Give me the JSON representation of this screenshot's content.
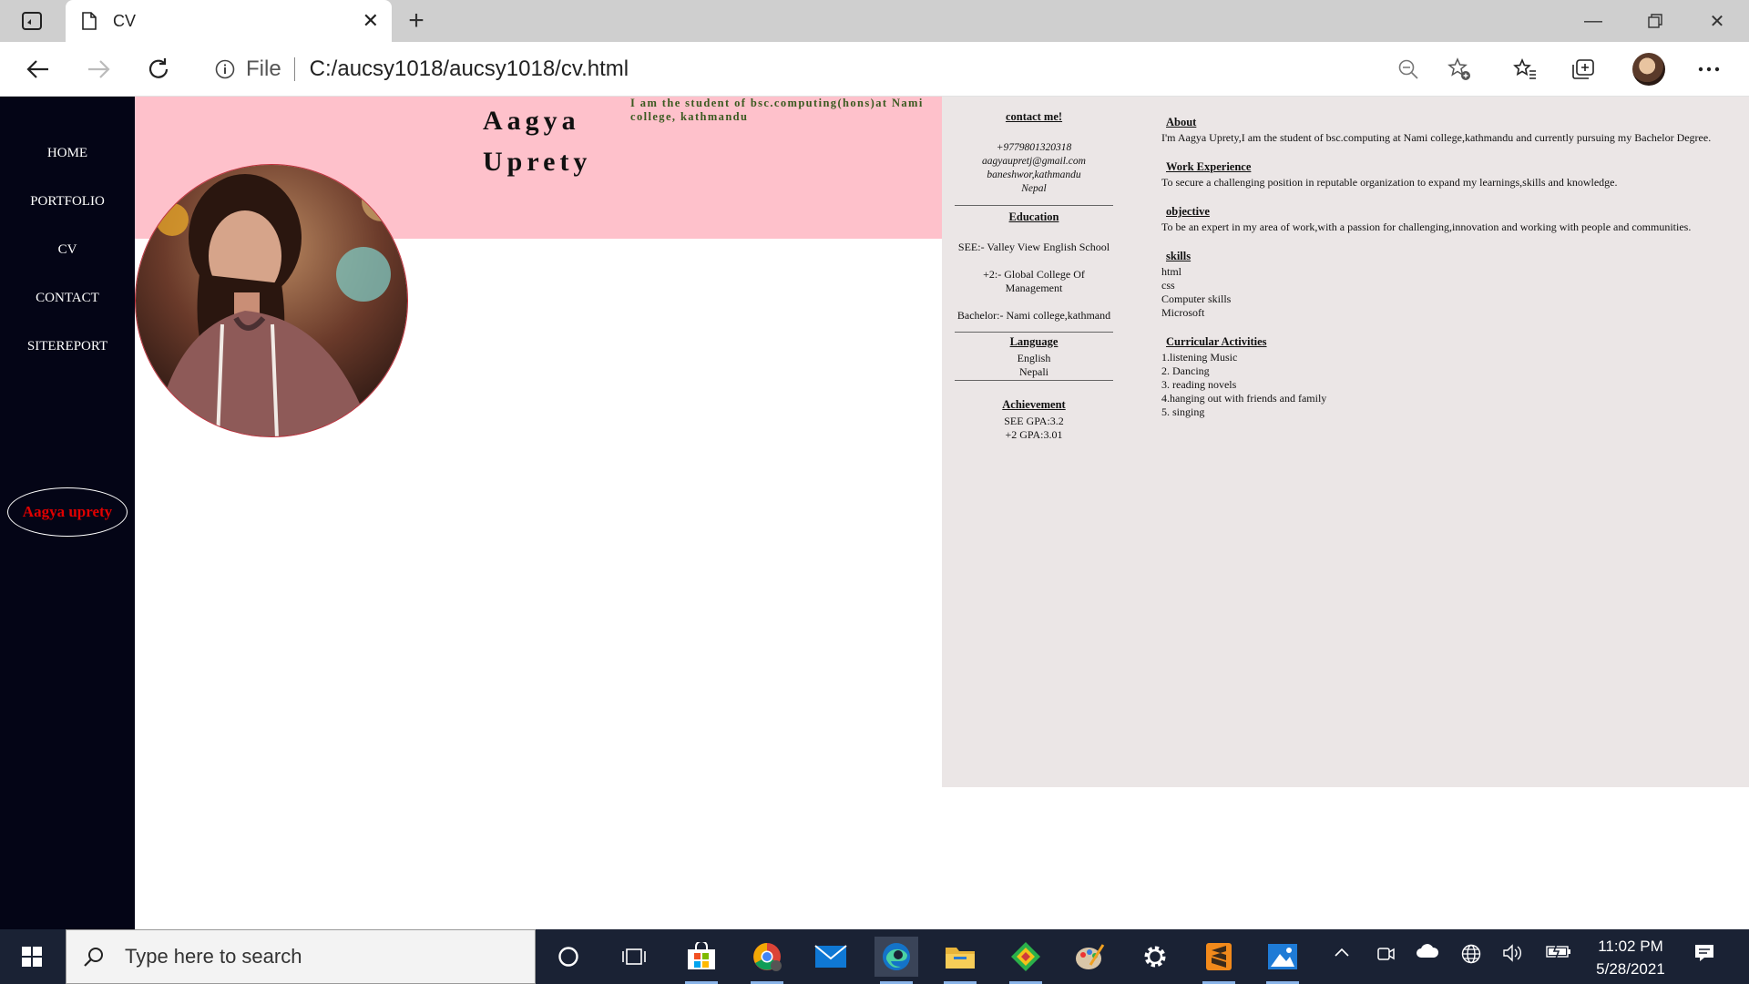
{
  "browser": {
    "tab_title": "CV",
    "address_scheme": "File",
    "address_url": "C:/aucsy1018/aucsy1018/cv.html"
  },
  "sidebar": {
    "nav": [
      "HOME",
      "PORTFOLIO",
      "CV",
      "CONTACT",
      "SITEREPORT"
    ],
    "owner_name": "Aagya uprety"
  },
  "header": {
    "name_first": "Aagya",
    "name_last": "Uprety",
    "tagline": "I am the student of bsc.computing(hons)at Nami college, kathmandu"
  },
  "contact": {
    "heading": "contact me!",
    "phone": "+9779801320318",
    "email": "aagyaupretj@gmail.com",
    "address": "baneshwor,kathmandu",
    "country": "Nepal"
  },
  "education": {
    "heading": "Education",
    "items": [
      "SEE:- Valley View English School",
      "+2:- Global College Of Management",
      "Bachelor:- Nami college,kathmand"
    ]
  },
  "language": {
    "heading": "Language",
    "items": [
      "English",
      "Nepali"
    ]
  },
  "achievement": {
    "heading": "Achievement",
    "items": [
      "SEE GPA:3.2",
      "+2 GPA:3.01"
    ]
  },
  "about": {
    "heading": "About",
    "text": "I'm Aagya Uprety,I am the student of bsc.computing at Nami college,kathmandu and currently pursuing my Bachelor Degree."
  },
  "work": {
    "heading": "Work Experience",
    "text": "To secure a challenging position in reputable organization to expand my learnings,skills and knowledge."
  },
  "objective": {
    "heading": "objective",
    "text": "To be an expert in my area of work,with a passion for challenging,innovation and working with people and communities."
  },
  "skills": {
    "heading": "skills",
    "items": [
      "html",
      "css",
      "Computer skills",
      "Microsoft"
    ]
  },
  "activities": {
    "heading": "Curricular Activities",
    "items": [
      "1.listening Music",
      "2. Dancing",
      "3. reading novels",
      "4.hanging out with friends and family",
      "5. singing"
    ]
  },
  "taskbar": {
    "search_placeholder": "Type here to search",
    "time": "11:02 PM",
    "date": "5/28/2021"
  },
  "colors": {
    "sidebar_bg": "#040516",
    "header_band": "#fec1cb",
    "cv_panel_bg": "#ebe6e6",
    "name_accent": "#e00000"
  }
}
